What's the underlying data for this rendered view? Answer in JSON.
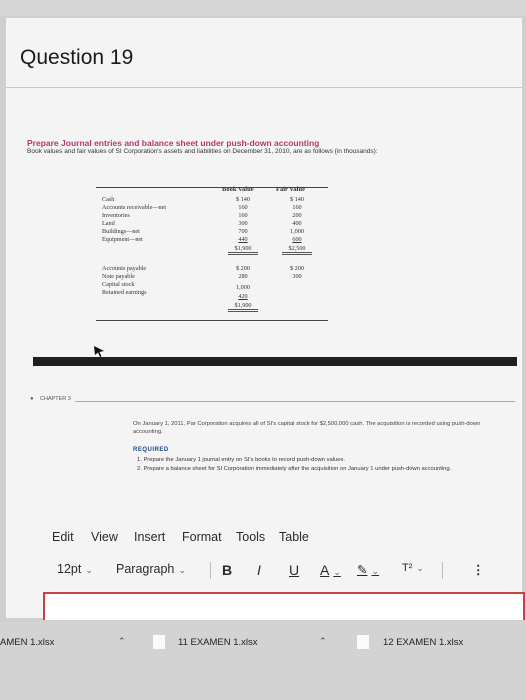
{
  "question": {
    "title": "Question 19"
  },
  "exercise": {
    "heading": "Prepare Journal entries and balance sheet under push-down accounting",
    "subtitle": "Book values and fair values of SI Corporation's assets and liabilities on December 31, 2010, are as follows (in thousands):"
  },
  "balance_sheet": {
    "col_book": "Book Value",
    "col_fair": "Fair Value",
    "assets": [
      {
        "label": "Cash",
        "book": "$ 140",
        "fair": "$ 140"
      },
      {
        "label": "Accounts receivable—net",
        "book": "160",
        "fair": "160"
      },
      {
        "label": "Inventories",
        "book": "160",
        "fair": "200"
      },
      {
        "label": "Land",
        "book": "300",
        "fair": "400"
      },
      {
        "label": "Buildings—net",
        "book": "700",
        "fair": "1,000"
      },
      {
        "label": "Equipment—net",
        "book": "440",
        "fair": "600"
      }
    ],
    "assets_total": {
      "book": "$1,900",
      "fair": "$2,500"
    },
    "liabilities": [
      {
        "label": "Accounts payable",
        "book": "$ 200",
        "fair": "$ 200"
      },
      {
        "label": "Note payable",
        "book": "280",
        "fair": "300"
      },
      {
        "label": "Capital stock",
        "book": "1,000",
        "fair": ""
      },
      {
        "label": "Retained earnings",
        "book": "420",
        "fair": ""
      }
    ],
    "liabilities_total": {
      "book": "$1,900"
    }
  },
  "chapter": {
    "label": "CHAPTER 3"
  },
  "problem": {
    "text": "On January 1, 2011, Par Corporation acquires all of SI's capital stock for $2,500,000 cash. The acquisition is recorded using push-down accounting.",
    "required_label": "REQUIRED",
    "items": [
      "1. Prepare the January 1 journal entry on SI's books to record push-down values.",
      "2. Prepare a balance sheet for SI Corporation immediately after the acquisition on January 1 under push-down accounting."
    ]
  },
  "editor": {
    "menu": [
      "Edit",
      "View",
      "Insert",
      "Format",
      "Tools",
      "Table"
    ],
    "font_size": "12pt",
    "block_style": "Paragraph",
    "bold": "B",
    "italic": "I",
    "underline": "U",
    "font_color": "A",
    "highlight": "✎",
    "superscript": "T²",
    "more": "⋮"
  },
  "downloads": [
    {
      "name": "AMEN 1.xlsx"
    },
    {
      "name": "11 EXAMEN 1.xlsx"
    },
    {
      "name": "12 EXAMEN 1.xlsx"
    }
  ],
  "colors": {
    "heading": "#b03a73",
    "required": "#1c4a87",
    "editor_border": "#c94040"
  },
  "icons": [
    "cursor-arrow-icon",
    "chevron-down-icon",
    "chevron-up-icon",
    "file-icon",
    "more-vertical-icon"
  ]
}
